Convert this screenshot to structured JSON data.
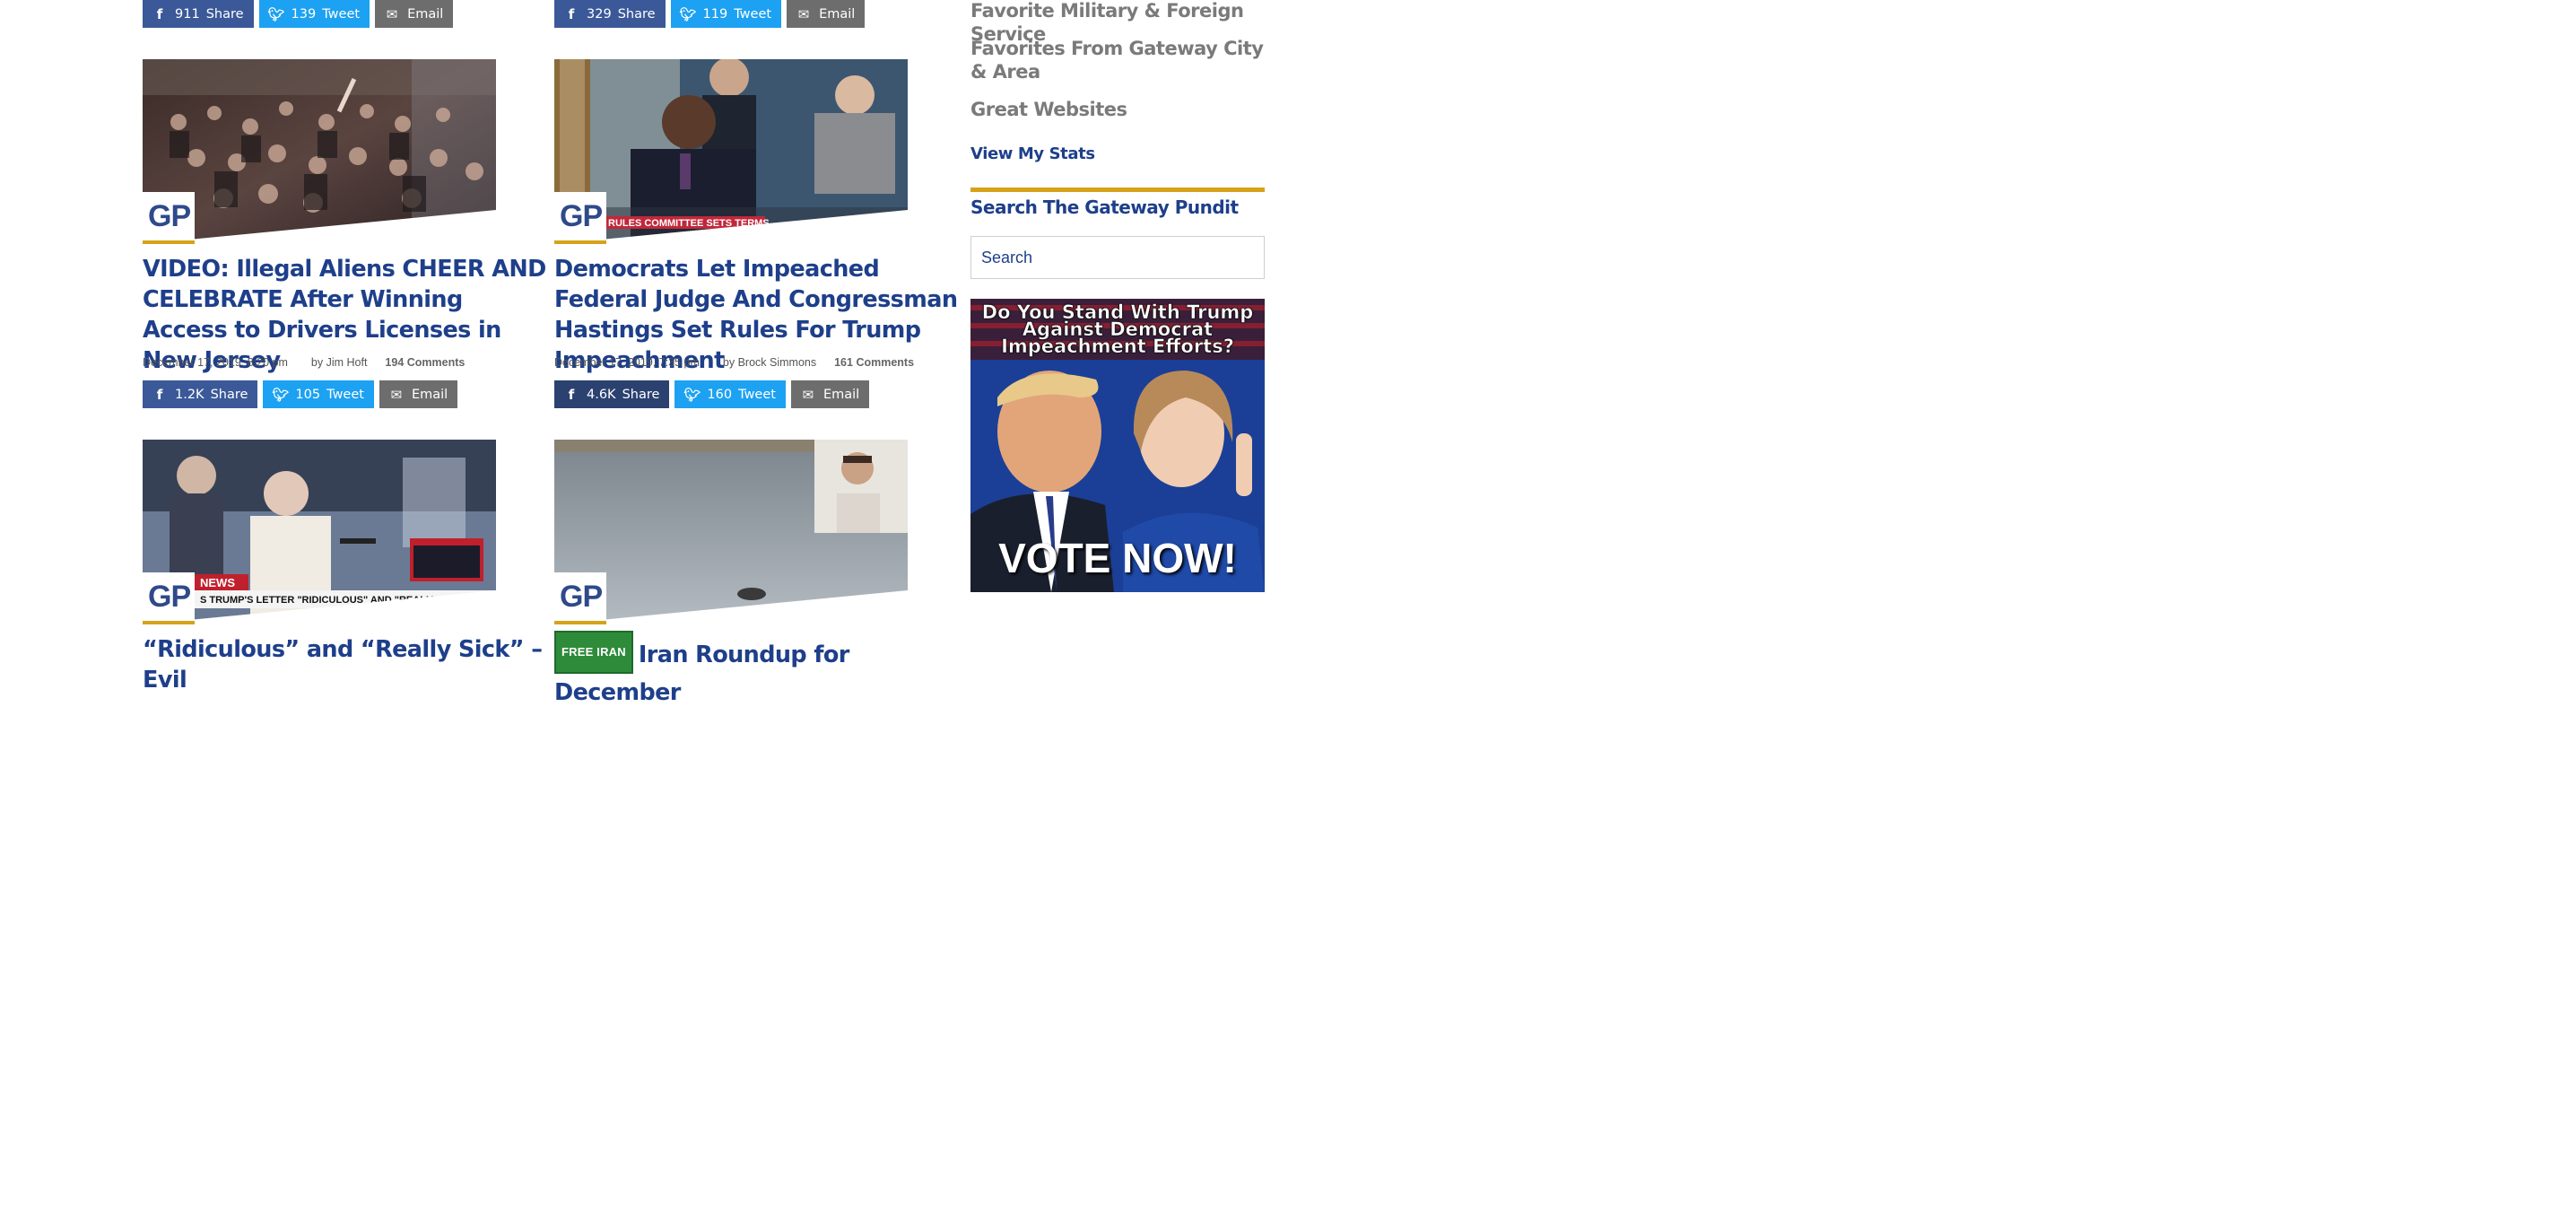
{
  "top_share_rows": [
    {
      "facebook": {
        "count": "911",
        "label": "Share"
      },
      "twitter": {
        "count": "139",
        "label": "Tweet"
      },
      "email": {
        "label": "Email"
      }
    },
    {
      "facebook": {
        "count": "329",
        "label": "Share"
      },
      "twitter": {
        "count": "119",
        "label": "Tweet"
      },
      "email": {
        "label": "Email"
      }
    }
  ],
  "articles": [
    {
      "headline": "VIDEO: Illegal Aliens CHEER AND CELEBRATE After Winning Access to Drivers Licenses in New Jersey",
      "date": "December 17, 2019, 8:20 pm",
      "author": "by Jim Hoft",
      "comments": "194 Comments",
      "share": {
        "facebook": {
          "count": "1.2K",
          "label": "Share"
        },
        "twitter": {
          "count": "105",
          "label": "Tweet"
        },
        "email": {
          "label": "Email"
        }
      }
    },
    {
      "headline": "Democrats Let Impeached Federal Judge And Congressman Hastings Set Rules For Trump Impeachment",
      "date": "December 17, 2019, 7:35 pm",
      "author": "by Brock Simmons",
      "comments": "161 Comments",
      "image_caption": "RULES COMMITTEE SETS TERMS",
      "share": {
        "facebook": {
          "count": "4.6K",
          "label": "Share"
        },
        "twitter": {
          "count": "160",
          "label": "Tweet"
        },
        "email": {
          "label": "Email"
        }
      }
    },
    {
      "headline": "“Ridiculous” and “Really Sick” – Evil",
      "image_caption_1": "NEWS",
      "image_caption_2": "S TRUMP'S LETTER \"RIDICULOUS\" AND \"REALLY SICK\""
    },
    {
      "badge": "FREE IRAN",
      "headline": "Iran Roundup for December"
    }
  ],
  "logo_text": "GP",
  "sidebar": {
    "links": [
      "Favorite Military & Foreign Service",
      "Favorites From Gateway City & Area",
      "Great Websites"
    ],
    "stats_link": "View My Stats",
    "search_title": "Search The Gateway Pundit",
    "search_placeholder": "Search",
    "ad": {
      "line1": "Do You Stand With Trump",
      "line2": "Against Democrat",
      "line3": "Impeachment Efforts?",
      "cta": "VOTE NOW!"
    }
  },
  "colors": {
    "facebook": "#3b5998",
    "twitter": "#1da1f2",
    "email": "#6d6d6d",
    "headline": "#1e3f8a",
    "accent_gold": "#d6a219",
    "badge_green": "#2e8b3a"
  }
}
